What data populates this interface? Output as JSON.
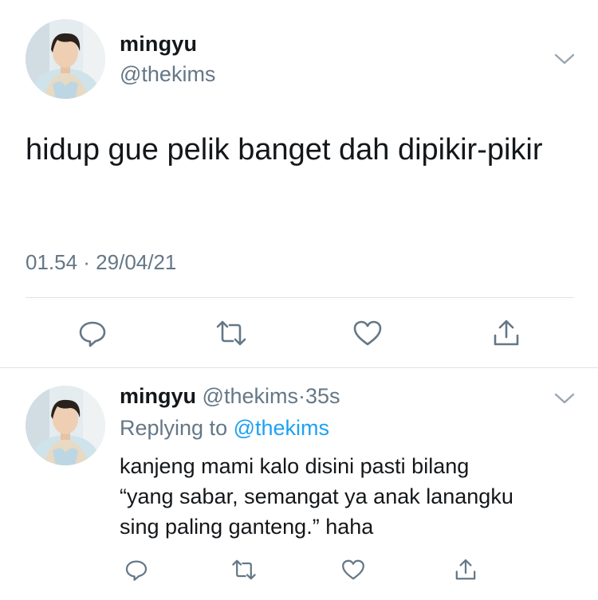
{
  "main_tweet": {
    "author_name": "mingyu",
    "author_handle": "@thekims",
    "text": "hidup gue pelik banget dah dipikir-pikir",
    "timestamp": "01.54 · 29/04/21",
    "actions": [
      "reply-icon",
      "retweet-icon",
      "like-icon",
      "share-icon"
    ]
  },
  "reply_tweet": {
    "author_name": "mingyu",
    "author_handle": "@thekims",
    "separator": "·",
    "time_ago": "35s",
    "replying_prefix": "Replying to",
    "replying_to": "@thekims",
    "text_line1": "kanjeng mami kalo disini pasti bilang",
    "text_line2": "“yang sabar, semangat ya anak lanangku",
    "text_line3": "sing paling ganteng.” haha",
    "actions": [
      "reply-icon",
      "retweet-icon",
      "like-icon",
      "share-icon"
    ]
  },
  "colors": {
    "primary_text": "#14171a",
    "secondary_text": "#657786",
    "link": "#1da1f2",
    "divider": "#dfe3e6"
  }
}
